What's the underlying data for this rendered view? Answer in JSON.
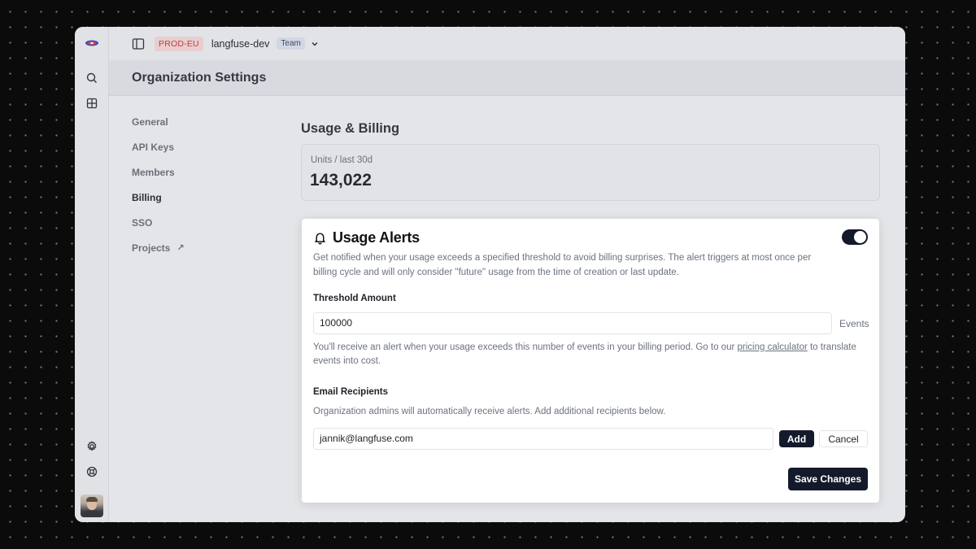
{
  "topbar": {
    "env_badge": "PROD-EU",
    "org_name": "langfuse-dev",
    "plan_badge": "Team"
  },
  "page": {
    "title": "Organization Settings"
  },
  "subnav": {
    "items": [
      {
        "label": "General"
      },
      {
        "label": "API Keys"
      },
      {
        "label": "Members"
      },
      {
        "label": "Billing",
        "active": true
      },
      {
        "label": "SSO"
      },
      {
        "label": "Projects",
        "external": true
      }
    ],
    "external_glyph": "↗"
  },
  "usage": {
    "section_title": "Usage & Billing",
    "card_label": "Units / last 30d",
    "card_value": "143,022"
  },
  "modal": {
    "title": "Usage Alerts",
    "enabled": true,
    "description": "Get notified when your usage exceeds a specified threshold to avoid billing surprises. The alert triggers at most once per billing cycle and will only consider \"future\" usage from the time of creation or last update.",
    "threshold_label": "Threshold Amount",
    "threshold_value": "100000",
    "threshold_unit": "Events",
    "help_prefix": "You'll receive an alert when your usage exceeds this number of events in your billing period. Go to our ",
    "help_link": "pricing calculator",
    "help_suffix": " to translate events into cost.",
    "recipients_label": "Email Recipients",
    "recipients_note": "Organization admins will automatically receive alerts. Add additional recipients below.",
    "email_value": "jannik@langfuse.com",
    "add_label": "Add",
    "cancel_label": "Cancel",
    "save_label": "Save Changes"
  },
  "icons": {
    "logo": "langfuse-logo-icon",
    "search": "search-icon",
    "dashboard": "dashboard-icon",
    "settings": "gear-icon",
    "support": "lifebuoy-icon",
    "sidebar_toggle": "sidebar-toggle-icon",
    "chevron": "chevron-down-icon",
    "bell": "bell-icon"
  },
  "colors": {
    "primary": "#141a2b",
    "env_badge_text": "#c53a3a",
    "env_badge_bg": "#f6d9d9"
  }
}
